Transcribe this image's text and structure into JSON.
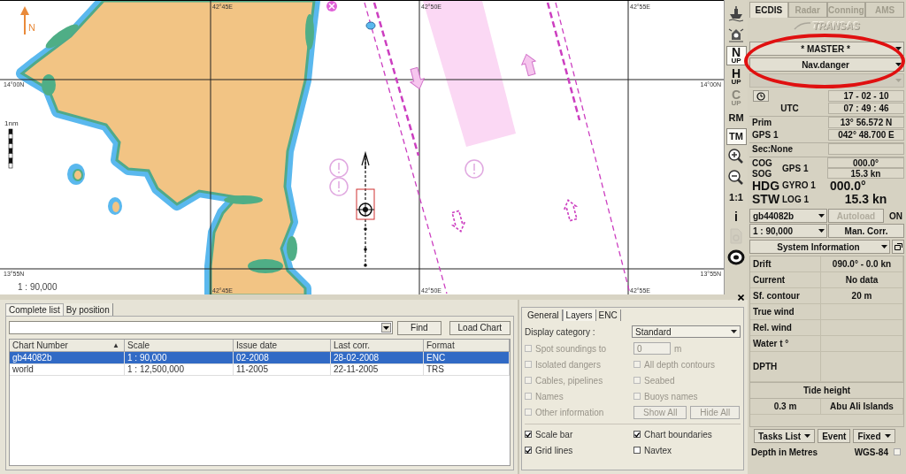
{
  "map": {
    "north_label": "N",
    "scale_bar_label": "1nm",
    "scale": "1 : 90,000",
    "top_labels": [
      "42°45E",
      "42°50E",
      "42°55E"
    ],
    "bottom_labels": [
      "42°45E",
      "42°50E",
      "42°55E"
    ],
    "left_labels": [
      "14°00N",
      "13°55N"
    ],
    "right_labels": [
      "14°00N",
      "13°55N"
    ]
  },
  "toolbar": [
    {
      "kind": "icon",
      "selected": false,
      "disabled": false
    },
    {
      "kind": "icon",
      "selected": false,
      "disabled": false
    },
    {
      "kind": "text",
      "top": "N",
      "bottom": "UP",
      "selected": true,
      "disabled": false
    },
    {
      "kind": "text",
      "top": "H",
      "bottom": "UP",
      "selected": false,
      "disabled": false
    },
    {
      "kind": "text",
      "top": "C",
      "bottom": "UP",
      "selected": false,
      "disabled": true
    },
    {
      "kind": "text",
      "top": "RM",
      "selected": false,
      "disabled": false
    },
    {
      "kind": "text",
      "top": "TM",
      "selected": true,
      "disabled": false
    },
    {
      "kind": "icon",
      "selected": false,
      "disabled": false
    },
    {
      "kind": "icon",
      "selected": false,
      "disabled": false
    },
    {
      "kind": "text",
      "top": "1:1",
      "selected": false,
      "disabled": false
    },
    {
      "kind": "text",
      "top": "i",
      "selected": false,
      "disabled": false
    },
    {
      "kind": "icon",
      "selected": false,
      "disabled": true
    },
    {
      "kind": "icon",
      "selected": false,
      "disabled": false
    }
  ],
  "right_panel": {
    "tabs": [
      {
        "label": "ECDIS",
        "selected": true
      },
      {
        "label": "Radar",
        "selected": false
      },
      {
        "label": "Conning",
        "selected": false
      },
      {
        "label": "AMS",
        "selected": false
      }
    ],
    "logo": "TRANSAS",
    "dropdowns": [
      {
        "value": "* MASTER *",
        "disabled": false
      },
      {
        "value": "Nav.danger",
        "disabled": false
      },
      {
        "disabled": true
      }
    ],
    "time": {
      "label": "UTC",
      "date": "17 - 02 - 10",
      "time": "07 : 49 : 46"
    },
    "position": {
      "source": "Prim",
      "sensor": "GPS 1",
      "lat": "13° 56.572 N",
      "lon": "042° 48.700 E"
    },
    "secondary": "Sec:None",
    "motion": {
      "cog_label": "COG",
      "sog_label": "SOG",
      "gps": "GPS 1",
      "cog": "000.0°",
      "sog": "15.3 kn",
      "hdg_label": "HDG",
      "gyro": "GYRO 1",
      "hdg": "000.0°",
      "stw_label": "STW",
      "log": "LOG 1",
      "stw": "15.3 kn"
    },
    "chart": {
      "number": "gb44082b",
      "autoload": "Autoload",
      "autoload_disabled": true,
      "autoload_state": "ON",
      "scale": "1 : 90,000",
      "correction": "Man. Corr."
    },
    "system_info": {
      "title": "System Information",
      "rows": [
        {
          "kind": "row",
          "label": "Drift",
          "value": "090.0° - 0.0 kn"
        },
        {
          "kind": "row",
          "label": "Current",
          "value": "No data"
        },
        {
          "kind": "row",
          "label": "Sf. contour",
          "value": "20 m"
        },
        {
          "kind": "row",
          "label": "True wind"
        },
        {
          "kind": "row",
          "label": "Rel. wind"
        },
        {
          "kind": "row",
          "label": "Water t °"
        },
        {
          "kind": "tall",
          "label": "DPTH"
        }
      ],
      "tide": {
        "title": "Tide height",
        "value": "0.3 m",
        "place": "Abu Ali Islands"
      }
    },
    "buttons": [
      {
        "label": "Tasks List",
        "dropdown": true
      },
      {
        "label": "Event",
        "dropdown": false
      },
      {
        "label": "Fixed",
        "dropdown": true
      }
    ],
    "footer": {
      "units": "Depth in Metres",
      "datum": "WGS-84",
      "checked": false
    }
  },
  "chart_list": {
    "tabs": [
      {
        "label": "Complete list",
        "selected": true
      },
      {
        "label": "By position",
        "selected": false
      }
    ],
    "buttons": [
      "Find",
      "Load Chart"
    ],
    "columns": [
      {
        "label": "Chart Number",
        "sort_mark": "▲"
      },
      {
        "label": "Scale"
      },
      {
        "label": "Issue date"
      },
      {
        "label": "Last corr."
      },
      {
        "label": "Format"
      }
    ],
    "rows": [
      {
        "cells": [
          "gb44082b",
          "1 : 90,000",
          "02-2008",
          "28-02-2008",
          "ENC"
        ],
        "selected": true
      },
      {
        "cells": [
          "world",
          "1 : 12,500,000",
          "11-2005",
          "22-11-2005",
          "TRS"
        ],
        "selected": false
      }
    ]
  },
  "layers": {
    "tabs": [
      {
        "label": "General",
        "selected": false
      },
      {
        "label": "Layers",
        "selected": true
      },
      {
        "label": "ENC",
        "selected": false
      }
    ],
    "display_category": {
      "label": "Display category :",
      "value": "Standard"
    },
    "options": [
      {
        "kind": "checkbox",
        "label": "Spot soundings to",
        "checked": false,
        "disabled": true
      },
      {
        "kind": "number",
        "value": "0",
        "unit": "m",
        "disabled": true
      },
      {
        "kind": "checkbox",
        "label": "Isolated dangers",
        "checked": false,
        "disabled": true
      },
      {
        "kind": "checkbox",
        "label": "All depth contours",
        "checked": false,
        "disabled": true
      },
      {
        "kind": "checkbox",
        "label": "Cables, pipelines",
        "checked": false,
        "disabled": true
      },
      {
        "kind": "checkbox",
        "label": "Seabed",
        "checked": false,
        "disabled": true
      },
      {
        "kind": "checkbox",
        "label": "Names",
        "checked": false,
        "disabled": true
      },
      {
        "kind": "checkbox",
        "label": "Buoys names",
        "checked": false,
        "disabled": true
      },
      {
        "kind": "checkbox",
        "label": "Other information",
        "checked": false,
        "disabled": true
      },
      {
        "kind": "buttons",
        "buttons": [
          "Show All",
          "Hide All"
        ],
        "disabled": true
      }
    ],
    "extra_options": [
      {
        "kind": "checkbox",
        "label": "Scale bar",
        "checked": true,
        "disabled": false
      },
      {
        "kind": "checkbox",
        "label": "Chart boundaries",
        "checked": true,
        "disabled": false
      },
      {
        "kind": "checkbox",
        "label": "Grid lines",
        "checked": true,
        "disabled": false
      },
      {
        "kind": "checkbox",
        "label": "Navtex",
        "checked": false,
        "disabled": false
      }
    ]
  }
}
